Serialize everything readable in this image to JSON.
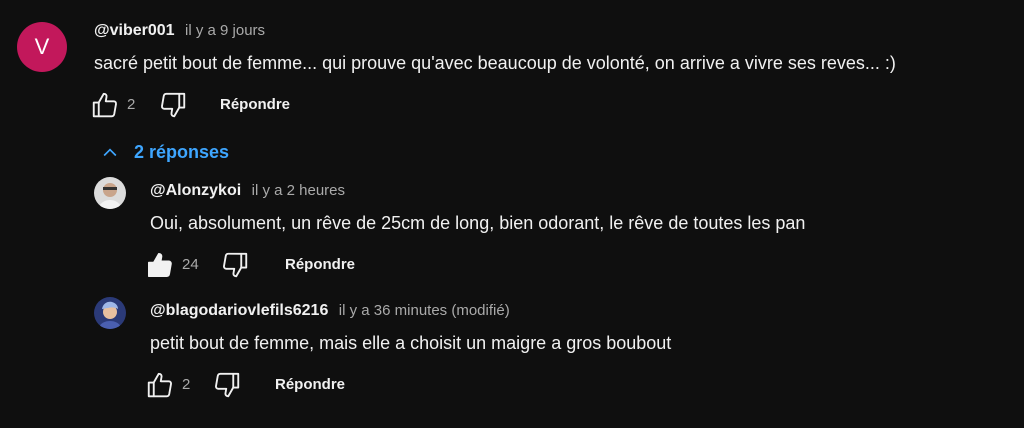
{
  "comments": [
    {
      "avatar_letter": "V",
      "handle": "@viber001",
      "time": "il y a 9 jours",
      "text": "sacré petit bout de femme... qui prouve qu'avec beaucoup de volonté, on arrive a vivre ses reves... :)",
      "likes": "2",
      "reply_label": "Répondre"
    }
  ],
  "replies_toggle": {
    "label": "2 réponses",
    "icon": "chevron-up-icon",
    "color": "#3ea6ff"
  },
  "replies": [
    {
      "handle": "@Alonzykoi",
      "time": "il y a 2 heures",
      "text": "Oui, absolument, un rêve de 25cm de long, bien odorant, le rêve de toutes les pan",
      "likes": "24",
      "liked": true,
      "reply_label": "Répondre"
    },
    {
      "handle": "@blagodariovlefils6216",
      "time": "il y a 36 minutes (modifié)",
      "text": "petit bout de femme, mais elle a choisit un maigre a gros boubout",
      "likes": "2",
      "liked": false,
      "reply_label": "Répondre"
    }
  ]
}
